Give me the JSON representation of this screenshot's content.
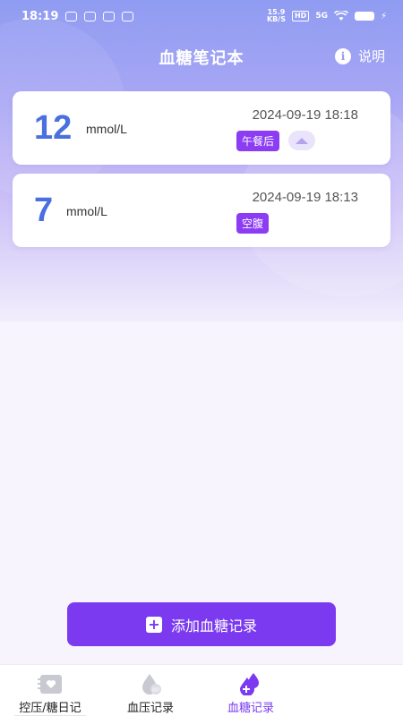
{
  "status_bar": {
    "time": "18:19",
    "speed": "15.9",
    "speed_unit": "KB/S",
    "hd": "HD",
    "network": "5G"
  },
  "header": {
    "title": "血糖笔记本",
    "help_label": "说明",
    "help_icon": "i"
  },
  "records": [
    {
      "value": "12",
      "unit": "mmol/L",
      "datetime": "2024-09-19 18:18",
      "tag": "午餐后",
      "has_cloud_icon": true
    },
    {
      "value": "7",
      "unit": "mmol/L",
      "datetime": "2024-09-19 18:13",
      "tag": "空腹",
      "has_cloud_icon": false
    }
  ],
  "add_button": {
    "label": "添加血糖记录"
  },
  "tabs": [
    {
      "label": "控压/糖日记",
      "active": false
    },
    {
      "label": "血压记录",
      "active": false
    },
    {
      "label": "血糖记录",
      "active": true
    }
  ],
  "colors": {
    "accent": "#7b3af0",
    "value_blue": "#4a6fe0",
    "tag_purple": "#8c3df4"
  }
}
